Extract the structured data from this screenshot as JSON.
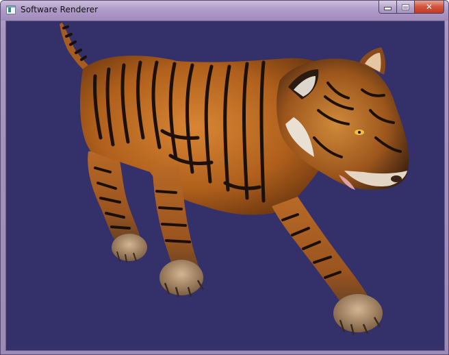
{
  "window": {
    "title": "Software Renderer",
    "icon": "app-window-icon",
    "controls": {
      "minimize": "minimize-icon",
      "maximize": "maximize-icon",
      "close": "close-icon",
      "close_glyph": "✕"
    }
  },
  "viewport": {
    "background_color": "#33306a",
    "scene": "tiger-3d-model"
  },
  "colors": {
    "title_bar": "#b09cc8",
    "close_button": "#c23a22",
    "fur": "#b8651c",
    "stripe": "#1c1008"
  }
}
